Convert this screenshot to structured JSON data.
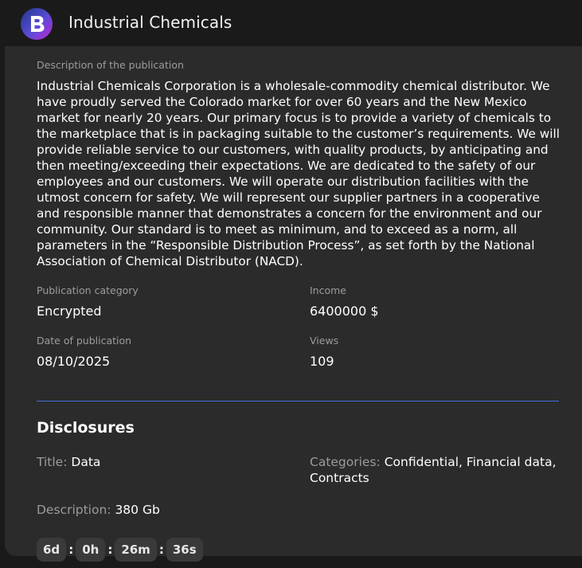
{
  "app": {
    "title": "Industrial Chemicals",
    "logo_icon": "b-logo-icon"
  },
  "publication": {
    "description_label": "Description of the publication",
    "description": "Industrial Chemicals Corporation is a wholesale-commodity chemical distributor. We have proudly served the Colorado market for over 60 years and the New Mexico market for nearly 20 years. Our primary focus is to provide a variety of chemicals to the marketplace that is in packaging suitable to the customer’s requirements. We will provide reliable service to our customers, with quality products, by anticipating and then meeting/exceeding their expectations. We are dedicated to the safety of our employees and our customers. We will operate our distribution facilities with the utmost concern for safety. We will represent our supplier partners in a cooperative and responsible manner that demonstrates a concern for the environment and our community. Our standard is to meet as minimum, and to exceed as a norm, all parameters in the “Responsible Distribution Process”, as set forth by the National Association of Chemical Distributor (NACD).",
    "category_label": "Publication category",
    "category": "Encrypted",
    "income_label": "Income",
    "income": "6400000 $",
    "date_label": "Date of publication",
    "date": "08/10/2025",
    "views_label": "Views",
    "views": "109"
  },
  "disclosures": {
    "heading": "Disclosures",
    "title_key": "Title:",
    "title_value": "Data",
    "categories_key": "Categories:",
    "categories_value_line1": "Confidential, Financial data,",
    "categories_value_line2": "Contracts",
    "description_key": "Description:",
    "description_value": "380 Gb",
    "countdown": {
      "days": "6d",
      "hours": "0h",
      "minutes": "26m",
      "seconds": "36s",
      "separator": ":"
    }
  },
  "colors": {
    "background": "#1a1a1a",
    "panel": "#2b2b2b",
    "divider": "#3f6fd6",
    "muted_text": "#9c9c9c"
  }
}
